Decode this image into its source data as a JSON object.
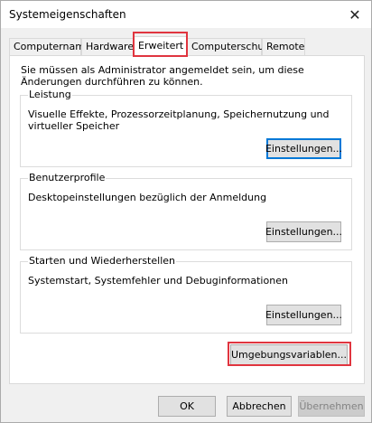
{
  "window": {
    "title": "Systemeigenschaften",
    "close_glyph": "✕"
  },
  "tabs": [
    {
      "label": "Computername"
    },
    {
      "label": "Hardware"
    },
    {
      "label": "Erweitert"
    },
    {
      "label": "Computerschutz"
    },
    {
      "label": "Remote"
    }
  ],
  "active_tab": "Erweitert",
  "intro": "Sie müssen als Administrator angemeldet sein, um diese Änderungen durchführen zu können.",
  "groups": [
    {
      "title": "Leistung",
      "text": "Visuelle Effekte, Prozessorzeitplanung, Speichernutzung und virtueller Speicher",
      "button": "Einstellungen..."
    },
    {
      "title": "Benutzerprofile",
      "text": "Desktopeinstellungen bezüglich der Anmeldung",
      "button": "Einstellungen..."
    },
    {
      "title": "Starten und Wiederherstellen",
      "text": "Systemstart, Systemfehler und Debuginformationen",
      "button": "Einstellungen..."
    }
  ],
  "env_button": "Umgebungsvariablen...",
  "footer": {
    "ok": "OK",
    "cancel": "Abbrechen",
    "apply": "Übernehmen"
  },
  "colors": {
    "highlight": "#e0353f",
    "focus": "#0078d7"
  }
}
